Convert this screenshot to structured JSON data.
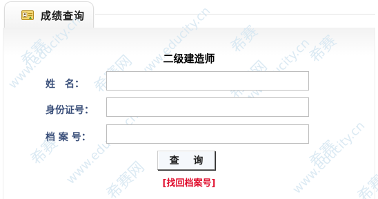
{
  "tab": {
    "title": "成绩查询",
    "icon": "id-card-icon"
  },
  "form": {
    "title": "二级建造师",
    "fields": [
      {
        "label": "姓　名：",
        "value": "",
        "placeholder": ""
      },
      {
        "label": "身份证号：",
        "value": "",
        "placeholder": ""
      },
      {
        "label": "档 案 号：",
        "value": "",
        "placeholder": ""
      }
    ],
    "submit_label": "查 询",
    "retrieve_link": "[找回档案号]"
  },
  "watermark": {
    "domain": "www.educity.cn",
    "brand": "希赛",
    "brand_alt": "希赛网"
  },
  "colors": {
    "label": "#3a4f7a",
    "link": "#e0102f",
    "watermark": "#d6e7f2"
  }
}
